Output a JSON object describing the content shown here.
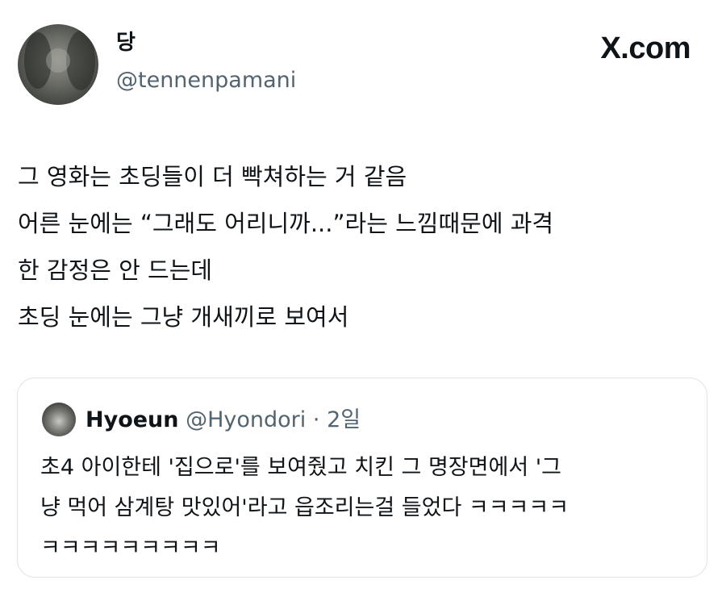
{
  "tweet": {
    "display_name": "당",
    "handle": "@tennenpamani",
    "platform": "X.com",
    "lines": [
      "그 영화는 초딩들이 더 빡쳐하는 거 같음",
      "어른 눈에는 “그래도 어리니까...”라는 느낌때문에 과격",
      "한 감정은 안 드는데",
      "초딩 눈에는 그냥 개새끼로 보여서"
    ]
  },
  "quoted": {
    "name": "Hyoeun",
    "handle": "@Hyondori",
    "separator": "·",
    "time": "2일",
    "lines": [
      "초4 아이한테 '집으로'를 보여줬고 치킨 그 명장면에서 '그",
      "냥 먹어 삼계탕 맛있어'라고 읍조리는걸 들었다 ㅋㅋㅋㅋㅋ",
      "ㅋㅋㅋㅋㅋㅋㅋㅋㅋ"
    ]
  },
  "colors": {
    "text": "#0f1419",
    "secondary_text": "#536471",
    "card_border": "#dfe3e6"
  }
}
